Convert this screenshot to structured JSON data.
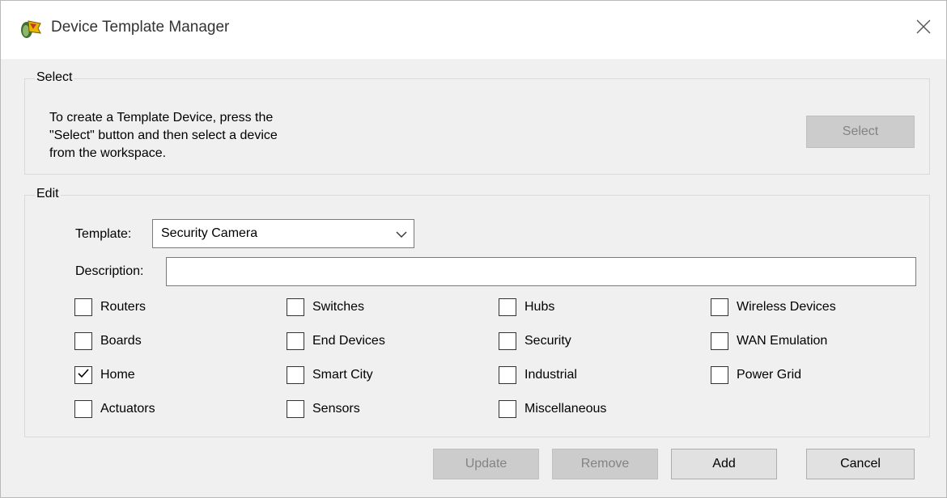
{
  "window": {
    "title": "Device Template Manager",
    "app_icon": "packet-tracer-icon",
    "close_icon": "close-icon"
  },
  "select_group": {
    "legend": "Select",
    "instructions": [
      "To create a Template Device, press the",
      "\"Select\" button and then select a device",
      "from the workspace."
    ],
    "select_button": "Select"
  },
  "edit_group": {
    "legend": "Edit",
    "template_label": "Template:",
    "template_value": "Security Camera",
    "description_label": "Description:",
    "description_value": "",
    "checkboxes": [
      {
        "label": "Routers",
        "checked": false
      },
      {
        "label": "Switches",
        "checked": false
      },
      {
        "label": "Hubs",
        "checked": false
      },
      {
        "label": "Wireless Devices",
        "checked": false
      },
      {
        "label": "Boards",
        "checked": false
      },
      {
        "label": "End Devices",
        "checked": false
      },
      {
        "label": "Security",
        "checked": false
      },
      {
        "label": "WAN Emulation",
        "checked": false
      },
      {
        "label": "Home",
        "checked": true
      },
      {
        "label": "Smart City",
        "checked": false
      },
      {
        "label": "Industrial",
        "checked": false
      },
      {
        "label": "Power Grid",
        "checked": false
      },
      {
        "label": "Actuators",
        "checked": false
      },
      {
        "label": "Sensors",
        "checked": false
      },
      {
        "label": "Miscellaneous",
        "checked": false
      }
    ]
  },
  "buttons": {
    "update": "Update",
    "remove": "Remove",
    "add": "Add",
    "cancel": "Cancel"
  }
}
